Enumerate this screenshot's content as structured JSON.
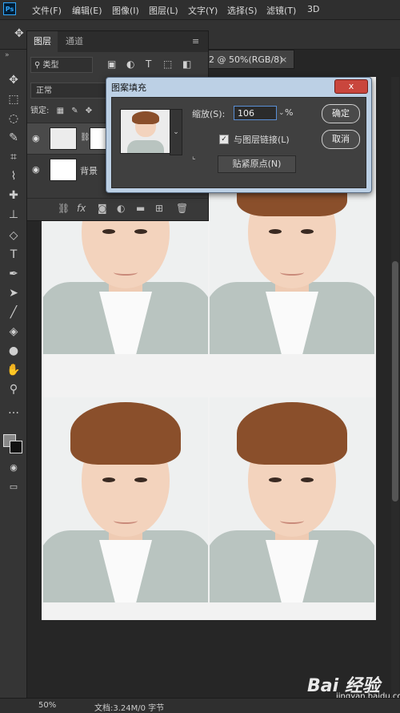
{
  "app": {
    "logo": "Ps"
  },
  "menu": [
    "文件(F)",
    "编辑(E)",
    "图像(I)",
    "图层(L)",
    "文字(Y)",
    "选择(S)",
    "滤镜(T)",
    "3D"
  ],
  "document": {
    "tab_title": "2 @ 50%(RGB/8)",
    "close": "×"
  },
  "layers_panel": {
    "tabs": [
      "图层",
      "通道"
    ],
    "filter_label": "类型",
    "blend_mode": "正常",
    "lock_label": "锁定:",
    "layers": [
      {
        "name": ""
      },
      {
        "name": "背景"
      }
    ]
  },
  "dialog": {
    "title": "图案填充",
    "close": "x",
    "scale_label": "缩放(S):",
    "scale_value": "106",
    "scale_unit": "%",
    "link_label": "与图层链接(L)",
    "link_checked": "✓",
    "snap_button": "贴紧原点(N)",
    "ok_button": "确定",
    "cancel_button": "取消"
  },
  "status": {
    "zoom": "50%",
    "doc_info": "文档:3.24M/0 字节"
  },
  "watermark": {
    "brand": "Bai 经验",
    "url": "jingyan.baidu.com"
  },
  "colors": {
    "accent": "#31a8ff",
    "dialog_frame": "#bcd0e5",
    "close_red": "#c9463d"
  }
}
